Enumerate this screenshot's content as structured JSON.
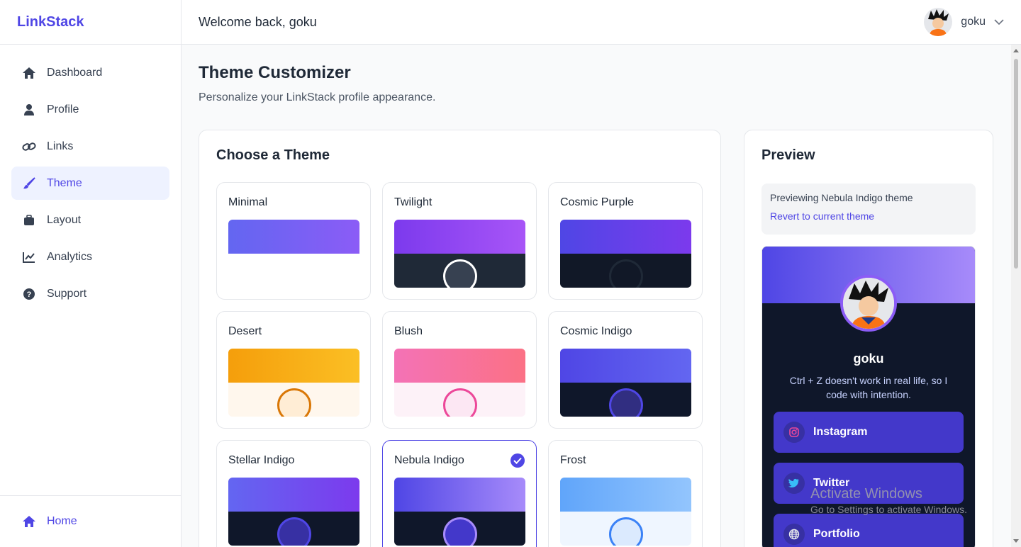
{
  "app": {
    "brand": "LinkStack"
  },
  "sidebar": {
    "items": [
      {
        "label": "Dashboard",
        "icon": "home-icon"
      },
      {
        "label": "Profile",
        "icon": "user-icon"
      },
      {
        "label": "Links",
        "icon": "link-icon"
      },
      {
        "label": "Theme",
        "icon": "brush-icon",
        "active": true
      },
      {
        "label": "Layout",
        "icon": "briefcase-icon"
      },
      {
        "label": "Analytics",
        "icon": "chart-line-icon"
      },
      {
        "label": "Support",
        "icon": "question-circle-icon"
      }
    ],
    "bottom": {
      "label": "Home",
      "icon": "home-icon"
    }
  },
  "header": {
    "welcome": "Welcome back, goku",
    "username": "goku"
  },
  "page": {
    "title": "Theme Customizer",
    "subtitle": "Personalize your LinkStack profile appearance."
  },
  "themes": {
    "title": "Choose a Theme",
    "items": [
      {
        "name": "Minimal",
        "top": "linear-gradient(90deg,#6366f1,#8b5cf6)",
        "bottom": "#ffffff",
        "ring": null,
        "ringFill": null
      },
      {
        "name": "Twilight",
        "top": "linear-gradient(90deg,#7c3aed,#a855f7)",
        "bottom": "#1f2937",
        "ring": "#ffffff",
        "ringFill": "#374151"
      },
      {
        "name": "Cosmic Purple",
        "top": "linear-gradient(90deg,#4f46e5,#7c3aed)",
        "bottom": "#111827",
        "ring": "#1f2937",
        "ringFill": "#111827"
      },
      {
        "name": "Desert",
        "top": "linear-gradient(90deg,#f59e0b,#fbbf24)",
        "bottom": "#fff7ed",
        "ring": "#d97706",
        "ringFill": "#ffedd5"
      },
      {
        "name": "Blush",
        "top": "linear-gradient(90deg,#f472b6,#fb7185)",
        "bottom": "#fdf2f8",
        "ring": "#ec4899",
        "ringFill": "#fce7f3"
      },
      {
        "name": "Cosmic Indigo",
        "top": "linear-gradient(90deg,#4f46e5,#6366f1)",
        "bottom": "#0f172a",
        "ring": "#4f46e5",
        "ringFill": "#312e81"
      },
      {
        "name": "Stellar Indigo",
        "top": "linear-gradient(90deg,#6366f1,#7c3aed)",
        "bottom": "#0f172a",
        "ring": "#4f46e5",
        "ringFill": "#3730a3"
      },
      {
        "name": "Nebula Indigo",
        "top": "linear-gradient(90deg,#4f46e5,#a78bfa)",
        "bottom": "#0f172a",
        "ring": "#a78bfa",
        "ringFill": "#4338ca",
        "selected": true
      },
      {
        "name": "Frost",
        "top": "linear-gradient(90deg,#60a5fa,#93c5fd)",
        "bottom": "#eff6ff",
        "ring": "#3b82f6",
        "ringFill": "#dbeafe"
      }
    ]
  },
  "preview": {
    "title": "Preview",
    "notice": "Previewing Nebula Indigo theme",
    "revert": "Revert to current theme",
    "name": "goku",
    "bio": "Ctrl + Z doesn't work in real life, so I code with intention.",
    "links": [
      {
        "label": "Instagram",
        "icon": "instagram-icon"
      },
      {
        "label": "Twitter",
        "icon": "twitter-icon"
      },
      {
        "label": "Portfolio",
        "icon": "globe-icon"
      }
    ]
  },
  "watermark": {
    "line1": "Activate Windows",
    "line2": "Go to Settings to activate Windows."
  },
  "colors": {
    "accent": "#4f46e5",
    "accentLight": "#eef2ff"
  }
}
